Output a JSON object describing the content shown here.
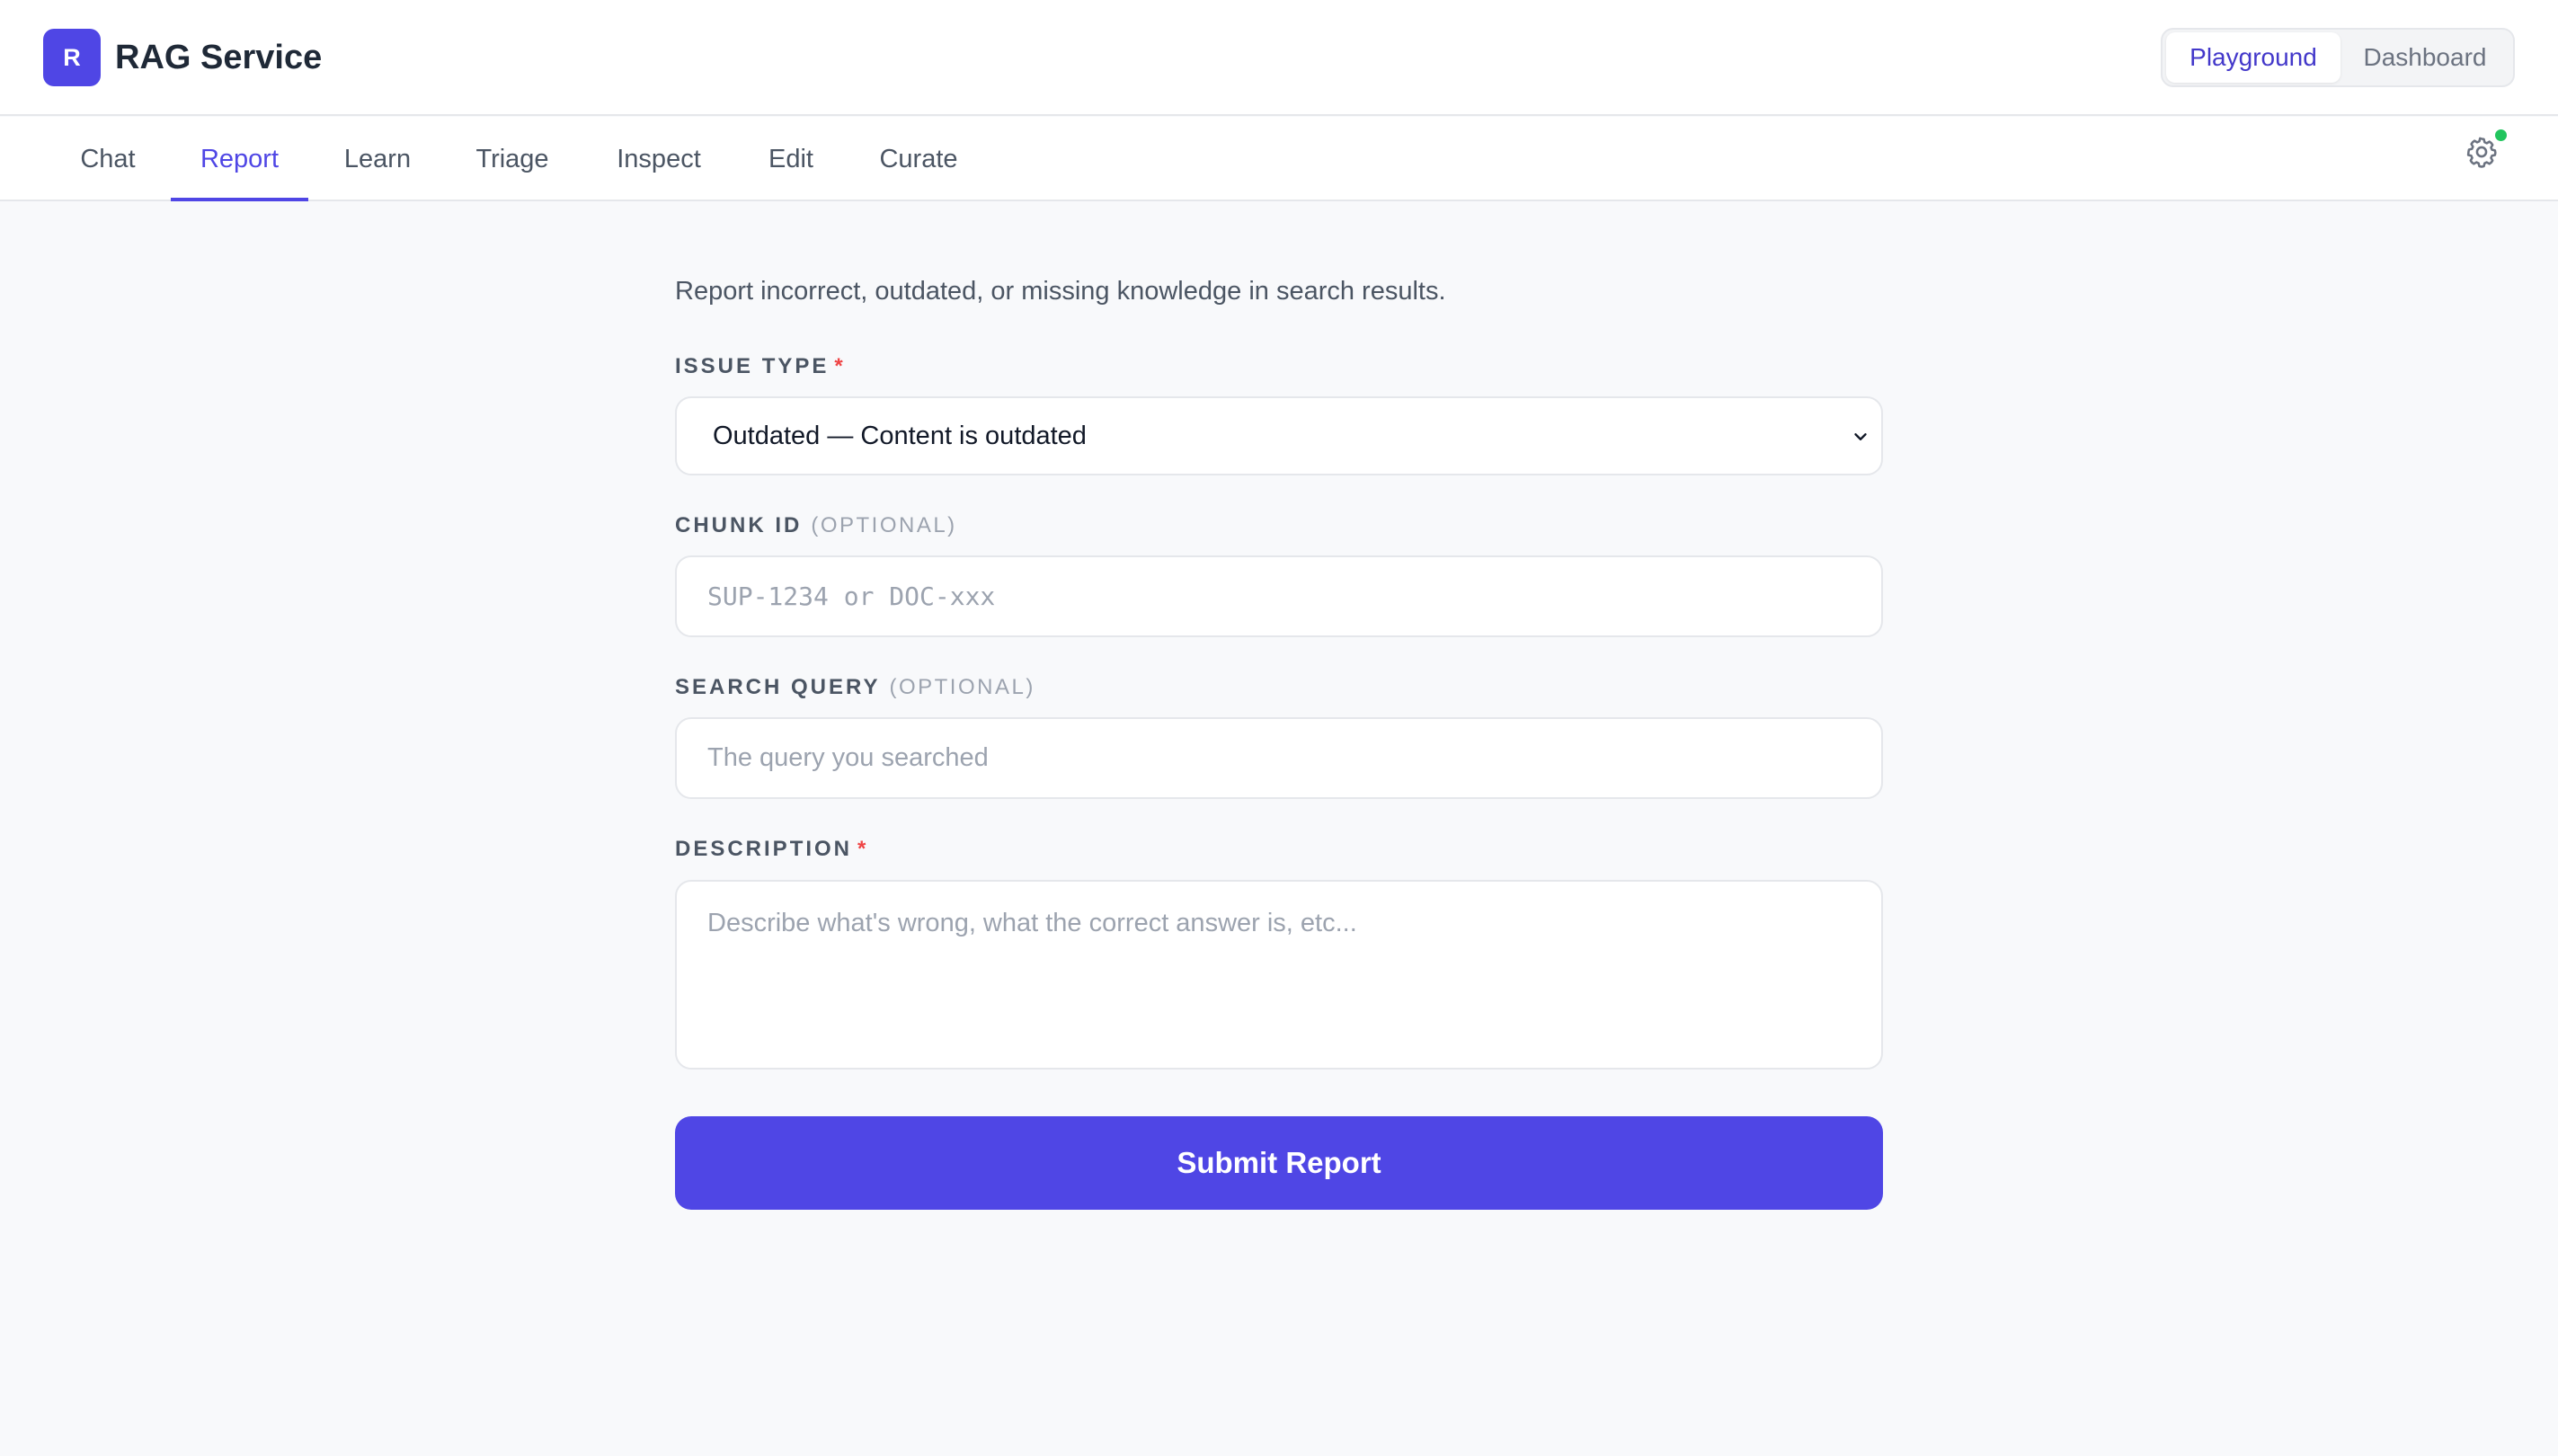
{
  "app": {
    "logo_letter": "R",
    "title": "RAG Service"
  },
  "mode_toggle": {
    "active": "Playground",
    "inactive": "Dashboard"
  },
  "tabs": [
    {
      "label": "Chat"
    },
    {
      "label": "Report"
    },
    {
      "label": "Learn"
    },
    {
      "label": "Triage"
    },
    {
      "label": "Inspect"
    },
    {
      "label": "Edit"
    },
    {
      "label": "Curate"
    }
  ],
  "active_tab": "Report",
  "status_indicator": {
    "color": "#22c55e",
    "icon": "gear-icon"
  },
  "form": {
    "intro": "Report incorrect, outdated, or missing knowledge in search results.",
    "issue_type": {
      "label": "ISSUE TYPE",
      "required_mark": "*",
      "value": "Outdated — Content is outdated"
    },
    "chunk_id": {
      "label": "CHUNK ID",
      "optional_tag": "(OPTIONAL)",
      "placeholder": "SUP-1234 or DOC-xxx"
    },
    "search_query": {
      "label": "SEARCH QUERY",
      "optional_tag": "(OPTIONAL)",
      "placeholder": "The query you searched"
    },
    "description": {
      "label": "DESCRIPTION",
      "required_mark": "*",
      "placeholder": "Describe what's wrong, what the correct answer is, etc..."
    },
    "submit_label": "Submit Report"
  },
  "colors": {
    "accent": "#4f46e5",
    "required": "#ef4444",
    "status_online": "#22c55e"
  }
}
